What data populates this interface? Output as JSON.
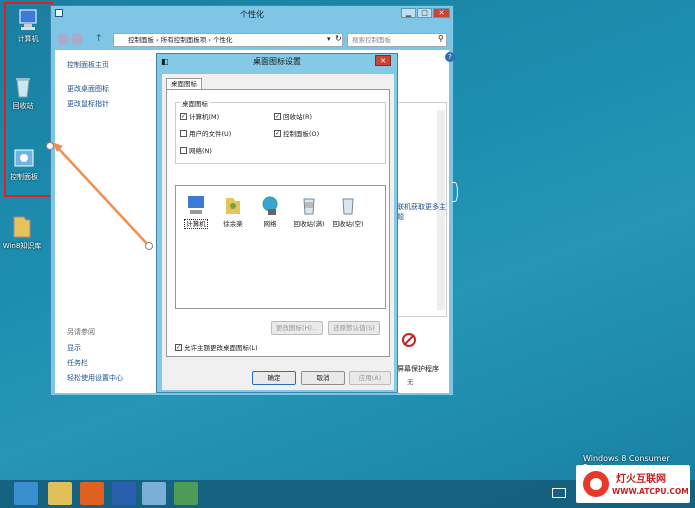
{
  "desktop": {
    "icons": [
      {
        "label": "计算机"
      },
      {
        "label": "回收站"
      },
      {
        "label": "控制面板"
      },
      {
        "label": "Win8知识库"
      }
    ],
    "watermark": "Windows 8 Consumer Preview"
  },
  "window": {
    "title": "个性化",
    "address": "控制面板 › 所有控制面板项 › 个性化",
    "search_placeholder": "搜索控制面板",
    "left_links": [
      "控制面板主页",
      "更改桌面图标",
      "更改鼠标指针"
    ],
    "see_also_heading": "另请参阅",
    "see_also_links": [
      "显示",
      "任务栏",
      "轻松使用设置中心"
    ],
    "right_more": "联机获取更多主题",
    "screensaver_label": "屏幕保护程序",
    "screensaver_value": "无",
    "help": "?"
  },
  "dialog": {
    "title": "桌面图标设置",
    "tab": "桌面图标",
    "group_label": "桌面图标",
    "checks": [
      {
        "label": "计算机(M)",
        "checked": true
      },
      {
        "label": "回收站(R)",
        "checked": true
      },
      {
        "label": "用户的文件(U)",
        "checked": false
      },
      {
        "label": "控制面板(O)",
        "checked": true
      },
      {
        "label": "网络(N)",
        "checked": false
      }
    ],
    "icons": [
      "计算机",
      "徐余楽",
      "网络",
      "回收站(满)",
      "回收站(空)"
    ],
    "change_icon": "更改图标(H)...",
    "restore_default": "还原默认值(S)",
    "allow_themes": "允许主题更改桌面图标(L)",
    "ok": "确定",
    "cancel": "取消",
    "apply": "应用(A)"
  },
  "logo": {
    "cn": "灯火互联网",
    "url": "WWW.ATCPU.COM"
  },
  "colors": {
    "highlight": "#e0201f",
    "arrow": "#f09050"
  }
}
